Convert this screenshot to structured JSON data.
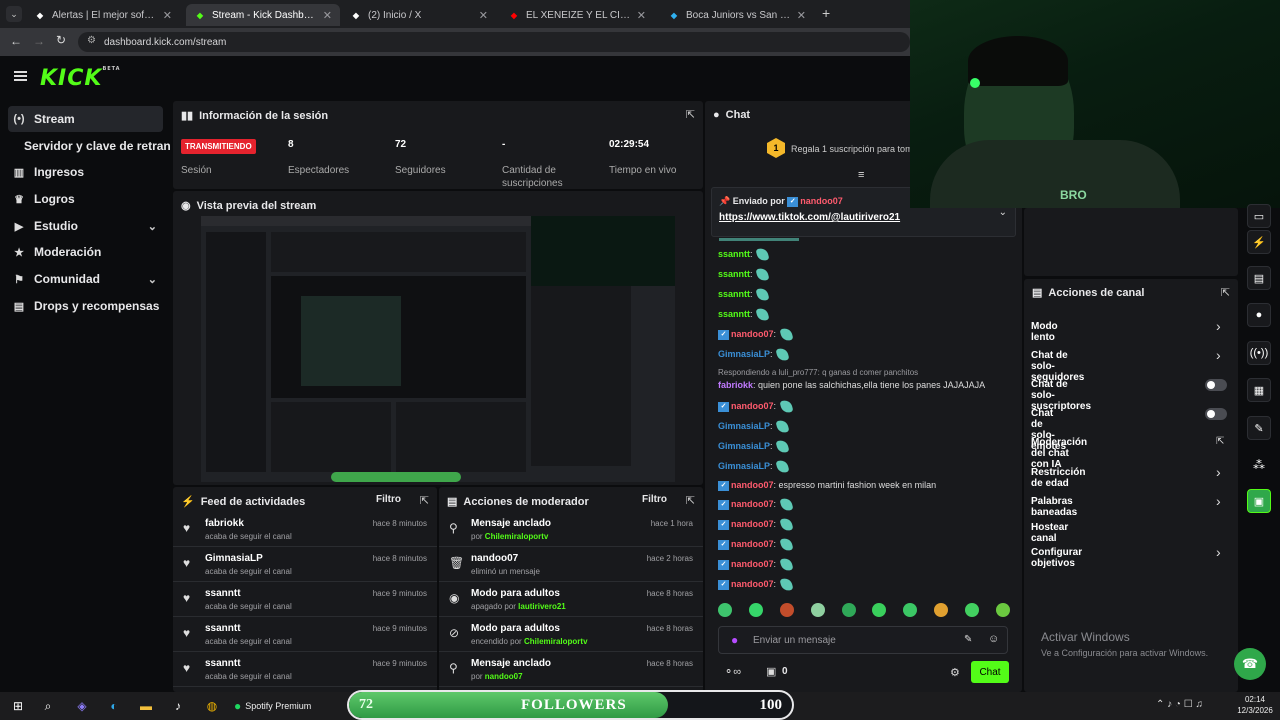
{
  "browser": {
    "tabs": [
      {
        "title": "Alertas | El mejor software para",
        "icon": "alert-icon",
        "color": "#ffffff"
      },
      {
        "title": "Stream - Kick Dashboard",
        "icon": "kick-icon",
        "color": "#53fc18"
      },
      {
        "title": "(2) Inicio / X",
        "icon": "x-icon",
        "color": "#ffffff"
      },
      {
        "title": "EL XENEIZE Y EL CICLÓN EMPA",
        "icon": "youtube-icon",
        "color": "#ff0000"
      },
      {
        "title": "Boca Juniors vs San Lorenzo - r",
        "icon": "sports-icon",
        "color": "#2fb0f0"
      }
    ],
    "url": "dashboard.kick.com/stream"
  },
  "logo": {
    "text": "KICK",
    "badge": "BETA"
  },
  "sidebar": {
    "items": [
      {
        "label": "Stream",
        "icon": "broadcast-icon"
      },
      {
        "label": "Servidor y clave de retransm",
        "icon": ""
      },
      {
        "label": "Ingresos",
        "icon": "chart-icon"
      },
      {
        "label": "Logros",
        "icon": "trophy-icon"
      },
      {
        "label": "Estudio",
        "icon": "studio-icon"
      },
      {
        "label": "Moderación",
        "icon": "shield-icon"
      },
      {
        "label": "Comunidad",
        "icon": "community-icon"
      },
      {
        "label": "Drops y recompensas",
        "icon": "gift-icon"
      }
    ]
  },
  "session": {
    "title": "Información de la sesión",
    "live_badge": "TRANSMITIENDO",
    "live_label": "Sesión",
    "stats": [
      {
        "value": "8",
        "label": "Espectadores"
      },
      {
        "value": "72",
        "label": "Seguidores"
      },
      {
        "value": "-",
        "label": "Cantidad de suscripciones"
      },
      {
        "value": "02:29:54",
        "label": "Tiempo en vivo"
      }
    ]
  },
  "preview": {
    "title": "Vista previa del stream"
  },
  "feed": {
    "title": "Feed de actividades",
    "filter": "Filtro",
    "items": [
      {
        "name": "fabriokk",
        "sub": "acaba de seguir el canal",
        "time": "hace 8 minutos"
      },
      {
        "name": "GimnasiaLP",
        "sub": "acaba de seguir el canal",
        "time": "hace 8 minutos"
      },
      {
        "name": "ssanntt",
        "sub": "acaba de seguir el canal",
        "time": "hace 9 minutos"
      },
      {
        "name": "ssanntt",
        "sub": "acaba de seguir el canal",
        "time": "hace 9 minutos"
      },
      {
        "name": "ssanntt",
        "sub": "acaba de seguir el canal",
        "time": "hace 9 minutos"
      }
    ]
  },
  "modactions": {
    "title": "Acciones de moderador",
    "filter": "Filtro",
    "items": [
      {
        "name": "Mensaje anclado",
        "pre": "por",
        "user": "Chilemiraloportv",
        "time": "hace 1 hora",
        "icon": "pin-icon"
      },
      {
        "name": "nandoo07",
        "pre": "eliminó un mensaje",
        "user": "",
        "time": "hace 2 horas",
        "icon": "trash-icon"
      },
      {
        "name": "Modo para adultos",
        "pre": "apagado por",
        "user": "lautirivero21",
        "time": "hace 8 horas",
        "icon": "eye-icon"
      },
      {
        "name": "Modo para adultos",
        "pre": "encendido por",
        "user": "Chilemiraloportv",
        "time": "hace 8 horas",
        "icon": "eye-off-icon"
      },
      {
        "name": "Mensaje anclado",
        "pre": "por",
        "user": "nandoo07",
        "time": "hace 8 horas",
        "icon": "pin-icon"
      }
    ]
  },
  "chat": {
    "title": "Chat",
    "gift_text": "Regala 1 suscripción para toma",
    "pinned_by_label": "Enviado por",
    "pinned_by_user": "nandoo07",
    "pinned_link": "https://www.tiktok.com/@lautirivero21",
    "messages": [
      {
        "user": "ssanntt",
        "text": "",
        "color": "#53fc18",
        "badge": false
      },
      {
        "user": "ssanntt",
        "text": "",
        "color": "#53fc18",
        "badge": false
      },
      {
        "user": "ssanntt",
        "text": "",
        "color": "#53fc18",
        "badge": false
      },
      {
        "user": "ssanntt",
        "text": "",
        "color": "#53fc18",
        "badge": false
      },
      {
        "user": "nandoo07",
        "text": "",
        "color": "#ff5b6e",
        "badge": true
      },
      {
        "user": "GimnasiaLP",
        "text": "",
        "color": "#3a8fd6",
        "badge": false
      },
      {
        "user": "fabriokk",
        "text": "quien pone las salchichas,ella tiene los panes JAJAJAJA",
        "color": "#c17aff",
        "badge": false,
        "reply": "Respondiendo a luli_pro777: q ganas d comer panchitos"
      },
      {
        "user": "nandoo07",
        "text": "",
        "color": "#ff5b6e",
        "badge": true
      },
      {
        "user": "GimnasiaLP",
        "text": "",
        "color": "#3a8fd6",
        "badge": false
      },
      {
        "user": "GimnasiaLP",
        "text": "",
        "color": "#3a8fd6",
        "badge": false
      },
      {
        "user": "GimnasiaLP",
        "text": "",
        "color": "#3a8fd6",
        "badge": false
      },
      {
        "user": "nandoo07",
        "text": "espresso martini fashion week en milan",
        "color": "#ff5b6e",
        "badge": true
      },
      {
        "user": "nandoo07",
        "text": "",
        "color": "#ff5b6e",
        "badge": true
      },
      {
        "user": "nandoo07",
        "text": "",
        "color": "#ff5b6e",
        "badge": true
      },
      {
        "user": "nandoo07",
        "text": "",
        "color": "#ff5b6e",
        "badge": true
      },
      {
        "user": "nandoo07",
        "text": "",
        "color": "#ff5b6e",
        "badge": true
      },
      {
        "user": "nandoo07",
        "text": "",
        "color": "#ff5b6e",
        "badge": true
      }
    ],
    "input_placeholder": "Enviar un mensaje",
    "points": "0",
    "send": "Chat"
  },
  "channel_actions": {
    "title": "Acciones de canal",
    "items": [
      {
        "label": "Modo lento",
        "control": "chevron"
      },
      {
        "label": "Chat de solo-seguidores",
        "control": "chevron"
      },
      {
        "label": "Chat de solo-suscriptores",
        "control": "toggle"
      },
      {
        "label": "Chat de solo-emotes",
        "control": "toggle"
      },
      {
        "label": "Moderación del chat con IA",
        "control": "external"
      },
      {
        "label": "Restricción de edad",
        "control": "chevron"
      },
      {
        "label": "Palabras baneadas",
        "control": "chevron"
      },
      {
        "label": "Hostear canal",
        "control": "none"
      },
      {
        "label": "Configurar objetivos",
        "control": "chevron"
      }
    ]
  },
  "activate": {
    "title": "Activar Windows",
    "sub": "Ve a Configuración para activar Windows."
  },
  "followers_bar": {
    "current": "72",
    "label": "FOLLOWERS",
    "goal": "100",
    "progress": 0.72
  },
  "taskbar": {
    "spotify": "Spotify Premium",
    "time": "02:14",
    "date": "12/3/2026"
  }
}
